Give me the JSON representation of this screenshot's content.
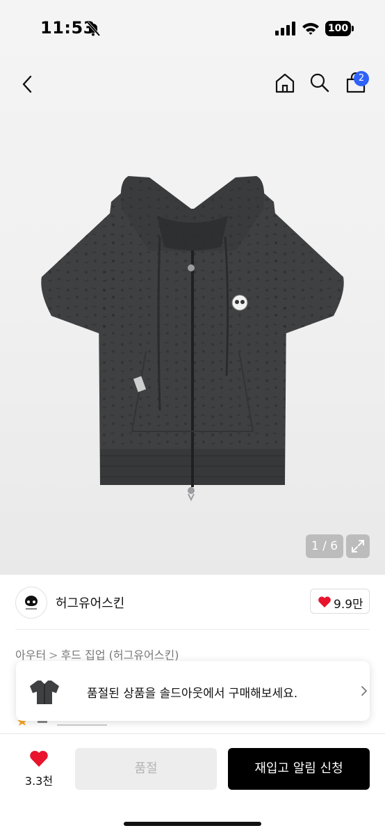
{
  "status_bar": {
    "time": "11:53",
    "battery": "100"
  },
  "nav": {
    "cart_count": "2"
  },
  "gallery": {
    "counter": "1 / 6"
  },
  "brand": {
    "name": "허그유어스킨",
    "like_count": "9.9만"
  },
  "breadcrumb": {
    "category": "아우터",
    "subcategory": "후드 집업 (허그유어스킨)"
  },
  "soldout_banner": {
    "text": "품절된 상품을 솔드아웃에서 구매해보세요."
  },
  "bottom": {
    "like_count": "3.3천",
    "soldout_label": "품절",
    "restock_label": "재입고 알림 신청"
  },
  "colors": {
    "badge": "#2f62f6",
    "like": "#e8142d",
    "primary": "#000000"
  }
}
